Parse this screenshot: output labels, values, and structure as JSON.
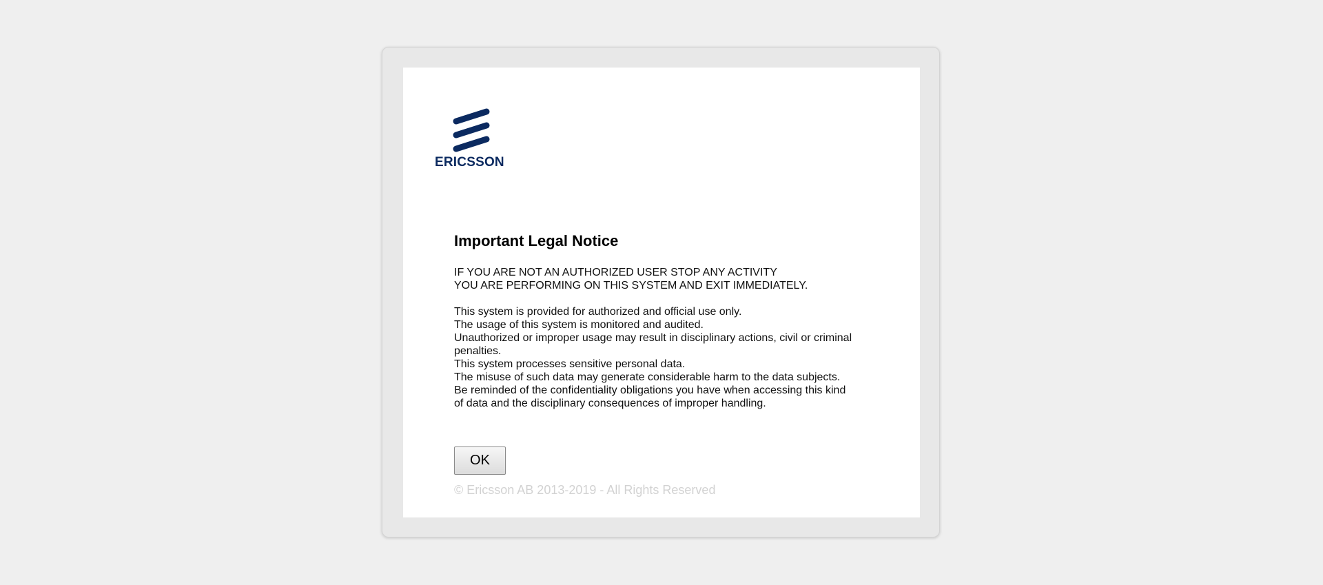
{
  "brand": {
    "name": "ERICSSON",
    "logo_icon": "ericsson-logo-icon",
    "color": "#0b2a60"
  },
  "notice": {
    "title": "Important Legal Notice",
    "warning_lines": [
      "IF YOU ARE NOT AN AUTHORIZED USER STOP ANY ACTIVITY",
      "YOU ARE PERFORMING ON THIS SYSTEM AND EXIT IMMEDIATELY."
    ],
    "body_lines": [
      "This system is provided for authorized and official use only.",
      "The usage of this system is monitored and audited.",
      "Unauthorized or improper usage may result in disciplinary actions, civil or criminal",
      "penalties.",
      "This system processes sensitive personal data.",
      "The misuse of such data may generate considerable harm to the data subjects.",
      "Be reminded of the confidentiality obligations you have when accessing this kind",
      "of data and the disciplinary consequences of improper handling."
    ]
  },
  "actions": {
    "ok_label": "OK"
  },
  "footer": {
    "copyright": "© Ericsson AB 2013-2019 - All Rights Reserved"
  }
}
